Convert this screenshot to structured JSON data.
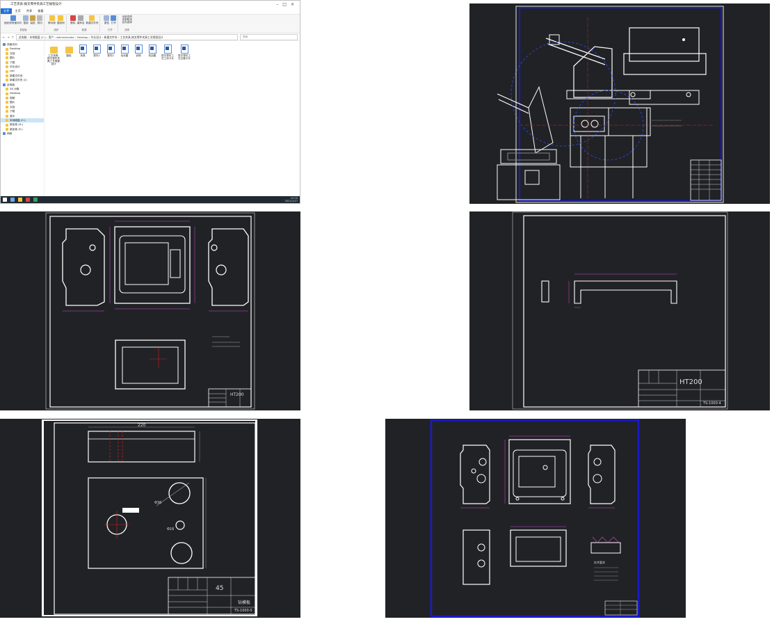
{
  "explorer": {
    "window_title": "工艺夹具-拨叉零件夹具工艺规程设计",
    "tabs": [
      "文件",
      "主页",
      "共享",
      "查看"
    ],
    "ribbon_groups": [
      {
        "label": "剪贴板",
        "items": [
          "固定到快速访问",
          "复制",
          "粘贴",
          "剪切"
        ]
      },
      {
        "label": "组织",
        "items": [
          "移动到",
          "复制到"
        ]
      },
      {
        "label": "新建",
        "items": [
          "删除",
          "重命名",
          "新建文件夹"
        ]
      },
      {
        "label": "打开",
        "items": [
          "属性",
          "打开"
        ]
      },
      {
        "label": "选择",
        "items": [
          "全部选择",
          "全部取消",
          "反向选择"
        ]
      }
    ],
    "address_path": "此电脑 › 本地磁盘 (C:) › 用户 › Administrator › Desktop › 毕业设计 › 新建文件夹 › 工艺夹具-拨叉零件夹具工艺规程设计",
    "search_placeholder": "搜索",
    "nav_items": [
      {
        "label": "快速访问",
        "group": true
      },
      {
        "label": "Desktop",
        "group": false
      },
      {
        "label": "文档",
        "group": false
      },
      {
        "label": "图片",
        "group": false
      },
      {
        "label": "下载",
        "group": false
      },
      {
        "label": "毕业设计",
        "group": false
      },
      {
        "label": "cad",
        "group": false
      },
      {
        "label": "新建文件夹",
        "group": false
      },
      {
        "label": "新建文件夹 (2)",
        "group": false
      },
      {
        "label": "此电脑",
        "group": true
      },
      {
        "label": "3D 对象",
        "group": false
      },
      {
        "label": "Desktop",
        "group": false
      },
      {
        "label": "视频",
        "group": false
      },
      {
        "label": "图片",
        "group": false
      },
      {
        "label": "文档",
        "group": false
      },
      {
        "label": "下载",
        "group": false
      },
      {
        "label": "音乐",
        "group": false
      },
      {
        "label": "本地磁盘 (C:)",
        "group": false,
        "selected": true
      },
      {
        "label": "新加卷 (D:)",
        "group": false
      },
      {
        "label": "新加卷 (E:)",
        "group": false
      },
      {
        "label": "网络",
        "group": true
      }
    ],
    "files": [
      {
        "name": "工艺夹具-拨叉零件夹具工艺规程设计",
        "kind": "folder"
      },
      {
        "name": "图纸",
        "kind": "folder"
      },
      {
        "name": "夹具",
        "kind": "doc"
      },
      {
        "name": "零件1",
        "kind": "doc"
      },
      {
        "name": "零件2",
        "kind": "doc"
      },
      {
        "name": "毛坯图",
        "kind": "doc"
      },
      {
        "name": "说明",
        "kind": "doc"
      },
      {
        "name": "机加图",
        "kind": "doc"
      },
      {
        "name": "拨叉零件工艺工序卡片",
        "kind": "doc"
      },
      {
        "name": "拨叉零件工艺过程卡片",
        "kind": "doc"
      }
    ],
    "status_text": "10 个项目",
    "tray_time": "10:20",
    "tray_date": "2021/1/27"
  },
  "drawings": {
    "material_ht200_a": "HT200",
    "material_ht200_b": "HT200",
    "material_45": "45",
    "plate_title": "钻模板",
    "part_code_a": "TS-1000-4",
    "part_code_b": "TS-1000-5",
    "dim_220": "220",
    "dim_phi": "Φ36",
    "dim_phi2": "Φ16",
    "note_heading": "技术要求"
  },
  "colors": {
    "cad_background": "#212226",
    "frame_white": "#ffffff",
    "frame_blue": "#1a1acc",
    "dim_magenta": "#d14bd1",
    "centerline_red": "#cc2222",
    "taskbar": "#1f2a33",
    "accent": "#1e6fd9"
  }
}
